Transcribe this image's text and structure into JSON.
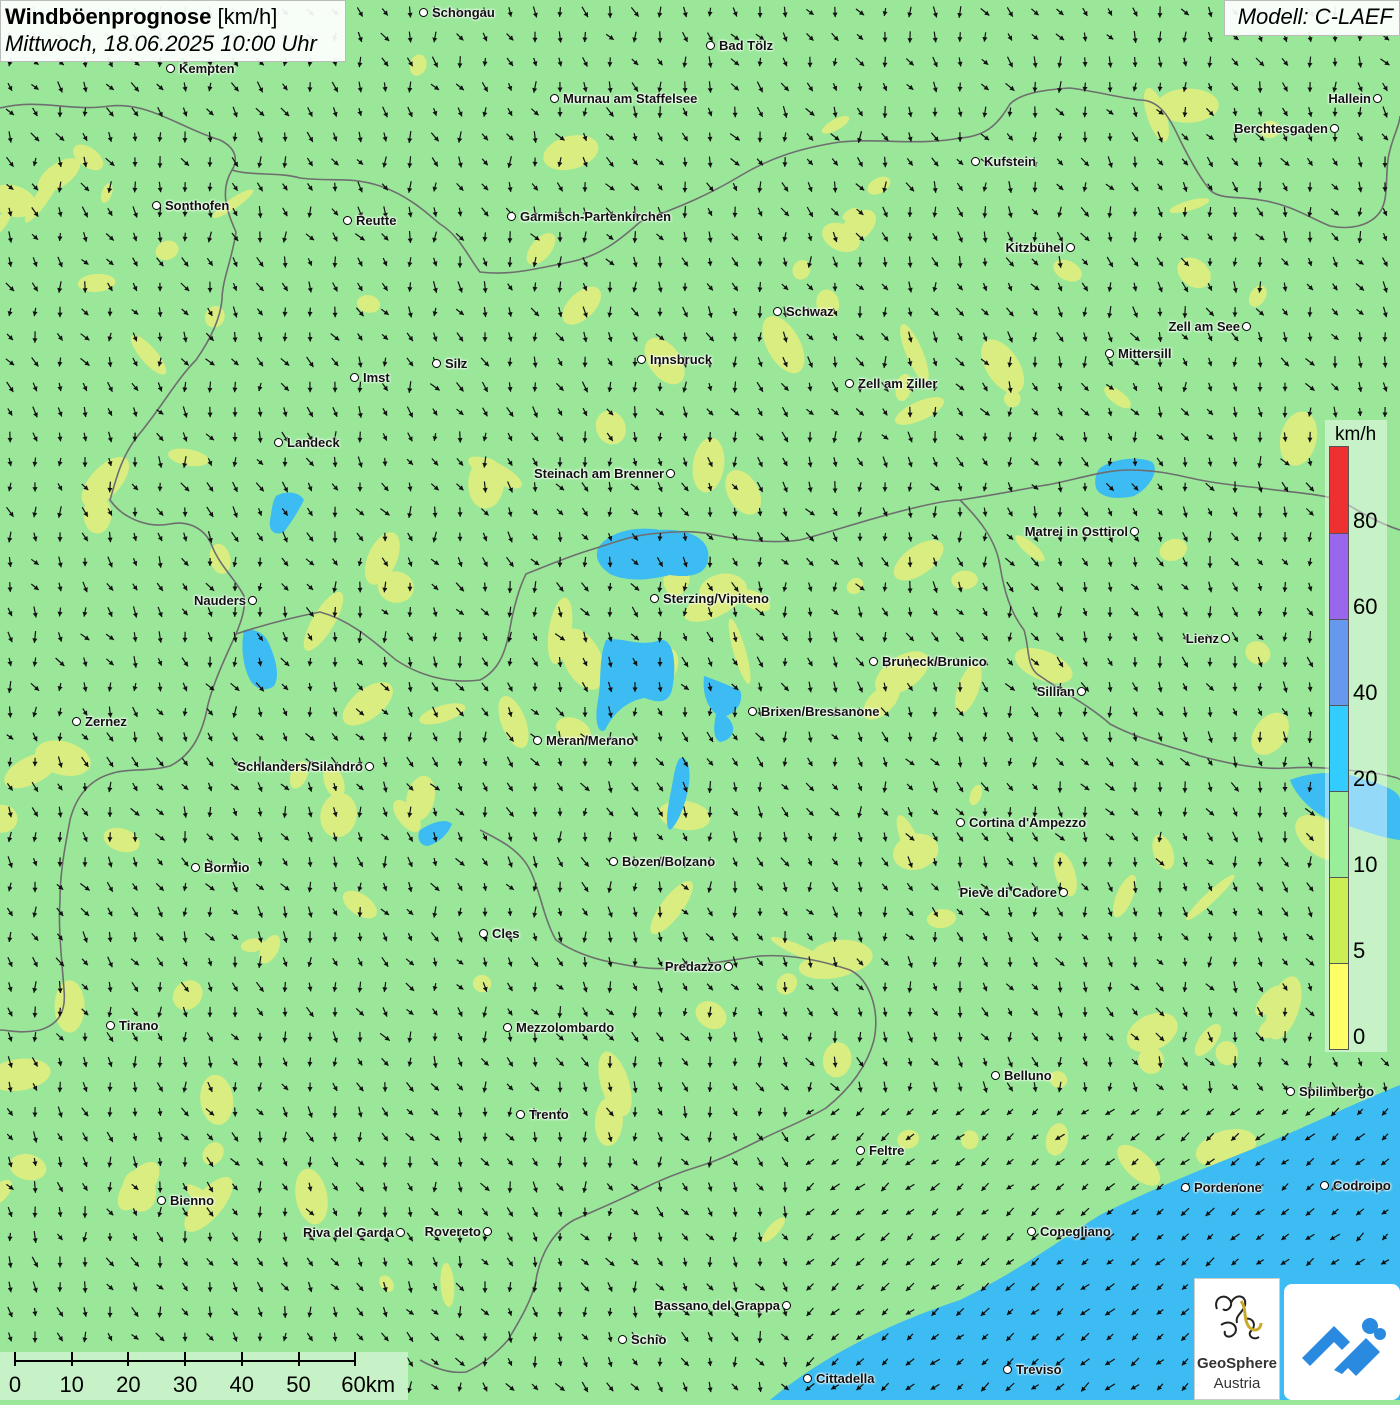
{
  "title": {
    "bold": "Windböenprognose",
    "unit": " [km/h]",
    "datetime": "Mittwoch, 18.06.2025 10:00 Uhr"
  },
  "model": "Modell: C-LAEF",
  "legend": {
    "unit": "km/h",
    "labels": [
      "80",
      "60",
      "40",
      "20",
      "10",
      "5",
      "0"
    ],
    "colors": [
      "#ee3030",
      "#9966ee",
      "#6699ee",
      "#33ccff",
      "#99ee99",
      "#ccee55",
      "#ffff66"
    ]
  },
  "scale": {
    "labels": [
      "0",
      "10",
      "20",
      "30",
      "40",
      "50",
      "60km"
    ]
  },
  "logos": {
    "geosphere_name": "GeoSphere",
    "geosphere_sub": "Austria"
  },
  "colors": {
    "background": "#9ae79a",
    "calm": "#e9ee7a",
    "strong": "#39baf2",
    "border": "#707070"
  },
  "cities": [
    {
      "name": "Schongau",
      "label_side": "right"
    },
    {
      "name": "Bad Tölz",
      "label_side": "right"
    },
    {
      "name": "Kempten",
      "label_side": "right"
    },
    {
      "name": "Murnau am Staffelsee",
      "label_side": "right"
    },
    {
      "name": "Hallein",
      "label_side": "left"
    },
    {
      "name": "Berchtesgaden",
      "label_side": "left"
    },
    {
      "name": "Kufstein",
      "label_side": "right"
    },
    {
      "name": "Sonthofen",
      "label_side": "right"
    },
    {
      "name": "Reutte",
      "label_side": "right"
    },
    {
      "name": "Garmisch-Partenkirchen",
      "label_side": "right"
    },
    {
      "name": "Kitzbühel",
      "label_side": "left"
    },
    {
      "name": "Schwaz",
      "label_side": "right"
    },
    {
      "name": "Zell am See",
      "label_side": "left"
    },
    {
      "name": "Mittersill",
      "label_side": "right"
    },
    {
      "name": "Silz",
      "label_side": "right"
    },
    {
      "name": "Innsbruck",
      "label_side": "right"
    },
    {
      "name": "Imst",
      "label_side": "right"
    },
    {
      "name": "Zell am Ziller",
      "label_side": "right"
    },
    {
      "name": "Landeck",
      "label_side": "right"
    },
    {
      "name": "Steinach am Brenner",
      "label_side": "left"
    },
    {
      "name": "Matrei in Osttirol",
      "label_side": "left"
    },
    {
      "name": "Nauders",
      "label_side": "left"
    },
    {
      "name": "Sterzing/Vipiteno",
      "label_side": "right"
    },
    {
      "name": "Lienz",
      "label_side": "left"
    },
    {
      "name": "Bruneck/Brunico",
      "label_side": "right"
    },
    {
      "name": "Sillian",
      "label_side": "left"
    },
    {
      "name": "Brixen/Bressanone",
      "label_side": "right"
    },
    {
      "name": "Zernez",
      "label_side": "right"
    },
    {
      "name": "Meran/Merano",
      "label_side": "right"
    },
    {
      "name": "Schlanders/Silandro",
      "label_side": "left"
    },
    {
      "name": "Cortina d'Ampezzo",
      "label_side": "right"
    },
    {
      "name": "Bozen/Bolzano",
      "label_side": "right"
    },
    {
      "name": "Bormio",
      "label_side": "right"
    },
    {
      "name": "Pieve di Cadore",
      "label_side": "left"
    },
    {
      "name": "Cles",
      "label_side": "right"
    },
    {
      "name": "Predazzo",
      "label_side": "left"
    },
    {
      "name": "Tirano",
      "label_side": "right"
    },
    {
      "name": "Mezzolombardo",
      "label_side": "right"
    },
    {
      "name": "Belluno",
      "label_side": "right"
    },
    {
      "name": "Spilimbergo",
      "label_side": "right"
    },
    {
      "name": "Trento",
      "label_side": "right"
    },
    {
      "name": "Feltre",
      "label_side": "right"
    },
    {
      "name": "Pordenone",
      "label_side": "right"
    },
    {
      "name": "Codroipo",
      "label_side": "right"
    },
    {
      "name": "Bienno",
      "label_side": "right"
    },
    {
      "name": "Riva del Garda",
      "label_side": "left"
    },
    {
      "name": "Rovereto",
      "label_side": "left"
    },
    {
      "name": "Conegliano",
      "label_side": "right"
    },
    {
      "name": "Bassano del Grappa",
      "label_side": "left"
    },
    {
      "name": "Schio",
      "label_side": "right"
    },
    {
      "name": "Treviso",
      "label_side": "right"
    },
    {
      "name": "Cittadella",
      "label_side": "right"
    }
  ]
}
